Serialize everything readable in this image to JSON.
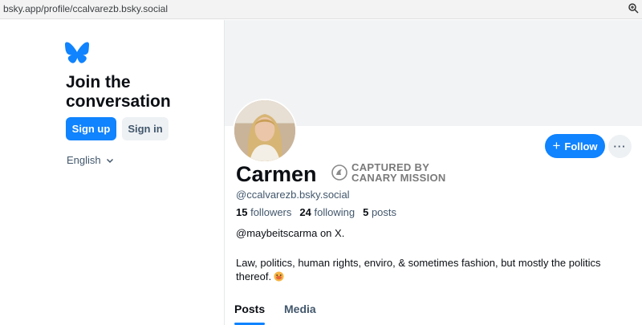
{
  "browser": {
    "url": "bsky.app/profile/ccalvarezb.bsky.social",
    "zoom_icon": "zoom-icon"
  },
  "sidebar": {
    "logo_icon": "butterfly-logo",
    "title": "Join the conversation",
    "signup_label": "Sign up",
    "signin_label": "Sign in",
    "language": "English"
  },
  "profile": {
    "display_name": "Carmen",
    "handle": "@ccalvarezb.bsky.social",
    "followers_count": "15",
    "followers_label": "followers",
    "following_count": "24",
    "following_label": "following",
    "posts_count": "5",
    "posts_label": "posts",
    "bio_line1": "@maybeitscarma on X.",
    "bio_line2": "Law, politics, human rights, enviro, & sometimes fashion, but mostly the politics thereof.",
    "follow_label": "Follow",
    "more_label": "···"
  },
  "watermark": {
    "line1": "CAPTURED BY",
    "line2": "CANARY MISSION"
  },
  "tabs": [
    {
      "label": "Posts",
      "active": true
    },
    {
      "label": "Media",
      "active": false
    }
  ],
  "colors": {
    "accent": "#1083fe",
    "muted_text": "#42576c",
    "banner": "#f2f3f5"
  }
}
